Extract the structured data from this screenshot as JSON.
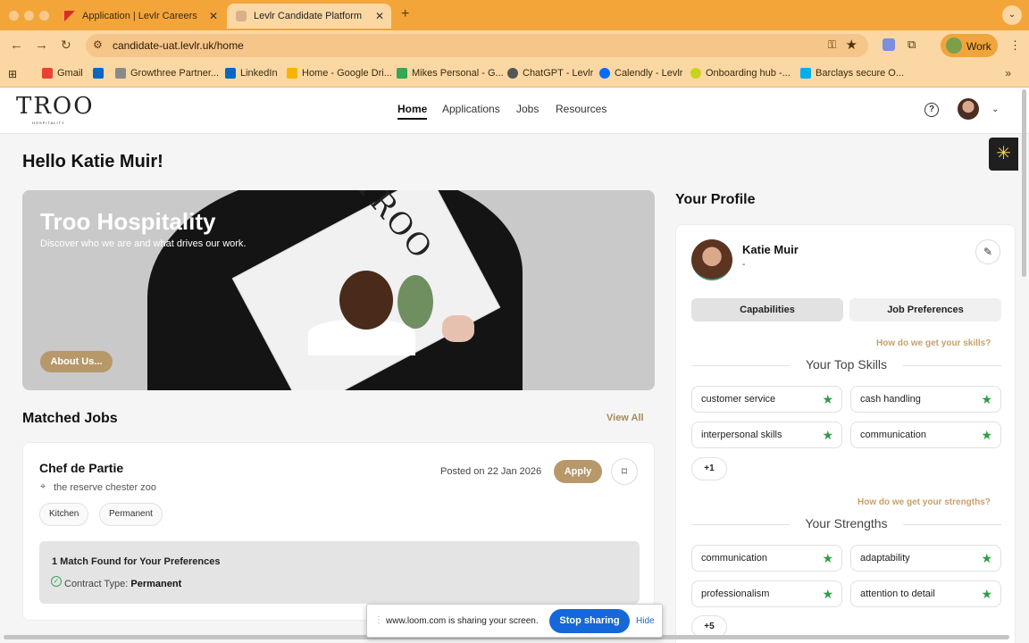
{
  "browser": {
    "tabs": [
      {
        "label": "Application | Levlr Careers"
      },
      {
        "label": "Levlr Candidate Platform"
      }
    ],
    "url": "candidate-uat.levlr.uk/home",
    "profile_label": "Work",
    "bookmarks": [
      "Gmail",
      "Growthree Partner...",
      "LinkedIn",
      "Home - Google Dri...",
      "Mikes Personal - G...",
      "ChatGPT - Levlr",
      "Calendly - Levlr",
      "Onboarding hub -...",
      "Barclays secure O..."
    ]
  },
  "site": {
    "logo": "TROO",
    "logo_sub": "HOSPITALITY",
    "nav": [
      {
        "label": "Home",
        "active": true
      },
      {
        "label": "Applications",
        "active": false
      },
      {
        "label": "Jobs",
        "active": false
      },
      {
        "label": "Resources",
        "active": false
      }
    ],
    "help_glyph": "?"
  },
  "greeting": "Hello Katie Muir!",
  "hero": {
    "title": "Troo Hospitality",
    "subtitle": "Discover who we are and what drives our work.",
    "button": "About Us...",
    "magazine_text": "TROO"
  },
  "matched_jobs": {
    "title": "Matched Jobs",
    "view_all": "View All",
    "job": {
      "title": "Chef de Partie",
      "location": "the reserve chester zoo",
      "posted": "Posted on 22 Jan 2026",
      "apply": "Apply",
      "tags": [
        "Kitchen",
        "Permanent"
      ],
      "match_heading": "1 Match Found for Your Preferences",
      "match_label": "Contract Type:",
      "match_value": "Permanent"
    }
  },
  "profile": {
    "title": "Your Profile",
    "name": "Katie Muir",
    "subtitle": "-",
    "tabs": [
      "Capabilities",
      "Job Preferences"
    ],
    "skills_link": "How do we get your skills?",
    "skills_heading": "Your Top Skills",
    "skills": [
      "customer service",
      "cash handling",
      "interpersonal skills",
      "communication"
    ],
    "skills_more": "+1",
    "strengths_link": "How do we get your strengths?",
    "strengths_heading": "Your Strengths",
    "strengths": [
      "communication",
      "adaptability",
      "professionalism",
      "attention to detail"
    ],
    "strengths_more": "+5"
  },
  "screen_share": {
    "message": "www.loom.com is sharing your screen.",
    "stop": "Stop sharing",
    "hide": "Hide"
  },
  "colors": {
    "accent_gold": "#b7986a",
    "skill_star": "#2e9e44",
    "browser_frame": "#f4a53a",
    "stop_button": "#1667d9"
  },
  "icons": {
    "skill_marker": "★",
    "location": "⌖",
    "bookmark": "⌑",
    "edit": "✎",
    "float_button": "✳"
  }
}
